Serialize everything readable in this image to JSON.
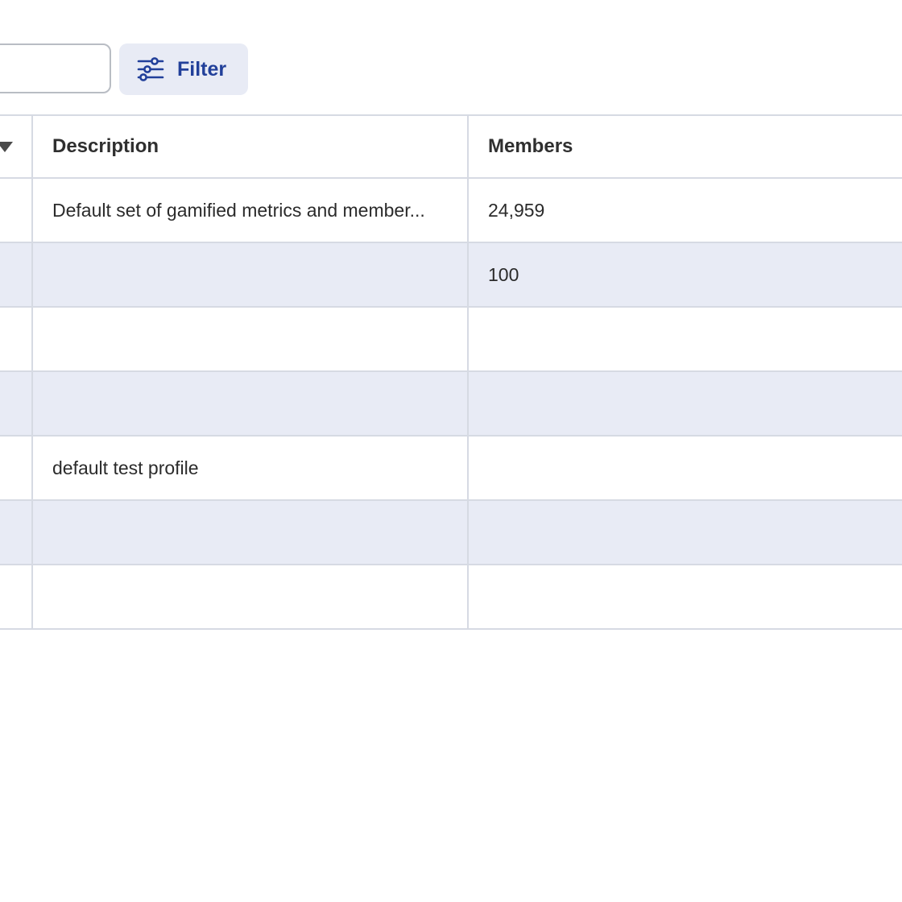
{
  "toolbar": {
    "search_value": "",
    "search_placeholder": "",
    "filter_label": "Filter",
    "filter_icon": "sliders-icon",
    "accent_color": "#22409a"
  },
  "table": {
    "columns": [
      {
        "key": "name",
        "label": ""
      },
      {
        "key": "description",
        "label": "Description"
      },
      {
        "key": "members",
        "label": "Members"
      }
    ],
    "sort_icon": "caret-down-icon",
    "rows": [
      {
        "description": "Default set of gamified metrics and member...",
        "members": "24,959"
      },
      {
        "description": "",
        "members": "100"
      },
      {
        "description": "",
        "members": ""
      },
      {
        "description": "",
        "members": ""
      },
      {
        "description": "default test profile",
        "members": ""
      },
      {
        "description": "",
        "members": ""
      },
      {
        "description": "",
        "members": ""
      }
    ],
    "alt_row_color": "#e8ebf5",
    "border_color": "#d6dae3"
  }
}
